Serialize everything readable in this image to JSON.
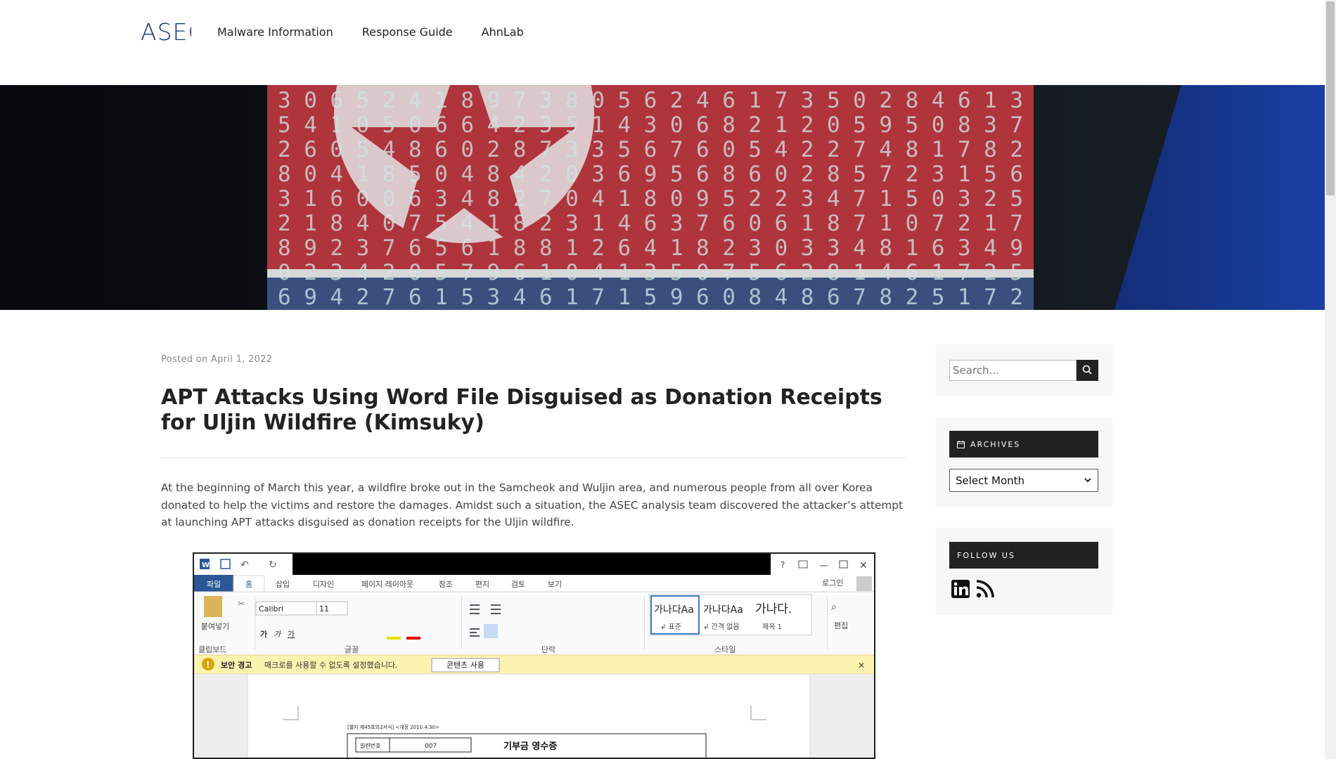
{
  "site": {
    "logo_text": "ASEC"
  },
  "nav": {
    "items": [
      "Malware Information",
      "Response Guide",
      "AhnLab"
    ]
  },
  "post": {
    "meta_prefix": "Posted on",
    "date": "April 1, 2022",
    "title": "APT Attacks Using Word File Disguised as Donation Receipts for Uljin Wildfire (Kimsuky)",
    "body": "At the beginning of March this year, a wildfire broke out in the Samcheok and Wuljin area, and numerous people from all over Korea donated to help the victims and restore the damages. Amidst such a situation, the ASEC analysis team discovered the attacker’s attempt at launching APT attacks disguised as donation receipts for the Uljin wildfire."
  },
  "word": {
    "tabs": [
      "파일",
      "홈",
      "삽입",
      "디자인",
      "페이지 레이아웃",
      "참조",
      "편지",
      "검토",
      "보기"
    ],
    "login": "로그인",
    "font_name": "Calibri",
    "font_size": "11",
    "paste_label": "붙여넣기",
    "group_labels": [
      "클립보드",
      "글꼴",
      "단락",
      "스타일"
    ],
    "styles": [
      {
        "sample": "가나다Aa",
        "name": "↲ 표준"
      },
      {
        "sample": "가나다Aa",
        "name": "↲ 간격 없음"
      },
      {
        "sample": "가나다.",
        "name": "제목 1"
      }
    ],
    "edit_label": "편집",
    "warning_title": "보안 경고",
    "warning_text": "매크로를 사용할 수 없도록 설정했습니다.",
    "enable_button": "콘텐츠 사용",
    "doc_header": "[별지 제45호의2서식] <개정 2010.4.30>",
    "serial_label": "일련번호",
    "serial_value": "007",
    "doc_title": "기부금 영수증"
  },
  "sidebar": {
    "search_placeholder": "Search...",
    "archives_title": "ARCHIVES",
    "archives_select": "Select Month",
    "follow_title": "FOLLOW US"
  },
  "hero_digits": [
    "3 0 6 5 2 4 1 8 9 7 3 8 0 5 6 2 4 6 1 7 3 5 0 2 8 4 6 1 3",
    "5 4 1 0 5 0 6 6 4 2 3 5 1 4 3 0 6 8 2 1 2 0 5 9 5 0 8 3 7",
    "2 6 0 5 4 8 6 0 2 8 7 3 3 5 6 7 6 0 5 4 2 2 7 4 8 1 7 8 2",
    "8 0 4 1 8 5 0 4 8 4 2 0 3 6 9 5 6 8 6 0 2 8 5 7 2 3 1 5 6",
    "3 1 6 0 0 6 3 4 8 2 7 0 4 1 8 0 9 5 2 2 3 4 7 1 5 0 3 2 5",
    "2 1 8 4 0 7 5 4 1 8 2 3 1 4 6 3 7 6 0 6 1 8 7 1 0 7 2 1 7",
    "8 9 2 3 7 6 5 6 1 8 8 1 2 6 4 1 8 2 3 0 3 3 4 8 1 6 3 4 9",
    "0 2 3 4 2 0 5 7 9 6 1 0 4 1 3 5 0 7 5 6 2 8 1 4 6 1 7 2 5",
    "6 9 4 2 7 6 1 5 3 4 6 1 7 1 5 9 6 0 8 4 8 6 7 8 2 5 1 7 2"
  ],
  "colors": {
    "flag_red": "#b0343c",
    "flag_blue": "#2a5aa0",
    "accent_blue": "#0e3ea8",
    "dark": "#222222"
  }
}
